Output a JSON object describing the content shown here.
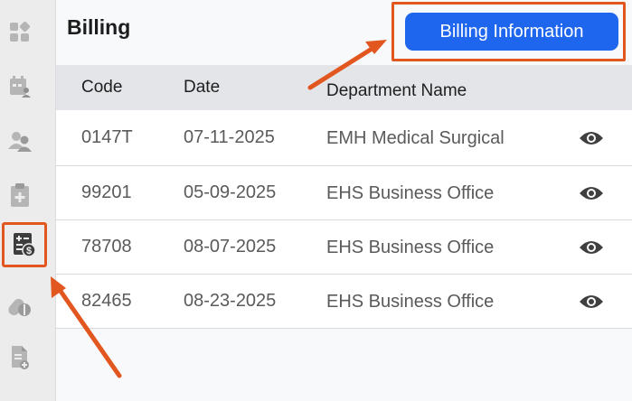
{
  "page": {
    "title": "Billing",
    "primary_button": "Billing Information"
  },
  "sidebar": {
    "items": [
      {
        "icon": "dashboard-icon",
        "active": false
      },
      {
        "icon": "calendar-user-icon",
        "active": false
      },
      {
        "icon": "users-icon",
        "active": false
      },
      {
        "icon": "clipboard-medical-icon",
        "active": false
      },
      {
        "icon": "billing-icon",
        "active": true
      },
      {
        "icon": "pills-icon",
        "active": false
      },
      {
        "icon": "document-medical-icon",
        "active": false
      }
    ]
  },
  "table": {
    "headers": {
      "code": "Code",
      "date": "Date",
      "department": "Department Name"
    },
    "rows": [
      {
        "code": "0147T",
        "date": "07-11-2025",
        "department": "EMH Medical Surgical"
      },
      {
        "code": "99201",
        "date": "05-09-2025",
        "department": "EHS Business Office"
      },
      {
        "code": "78708",
        "date": "08-07-2025",
        "department": "EHS Business Office"
      },
      {
        "code": "82465",
        "date": "08-23-2025",
        "department": "EHS Business Office"
      }
    ]
  },
  "colors": {
    "accent": "#1f66ee",
    "highlight": "#e2561f",
    "sidebar_bg": "#ececec",
    "header_bg": "#e3e5e9"
  }
}
